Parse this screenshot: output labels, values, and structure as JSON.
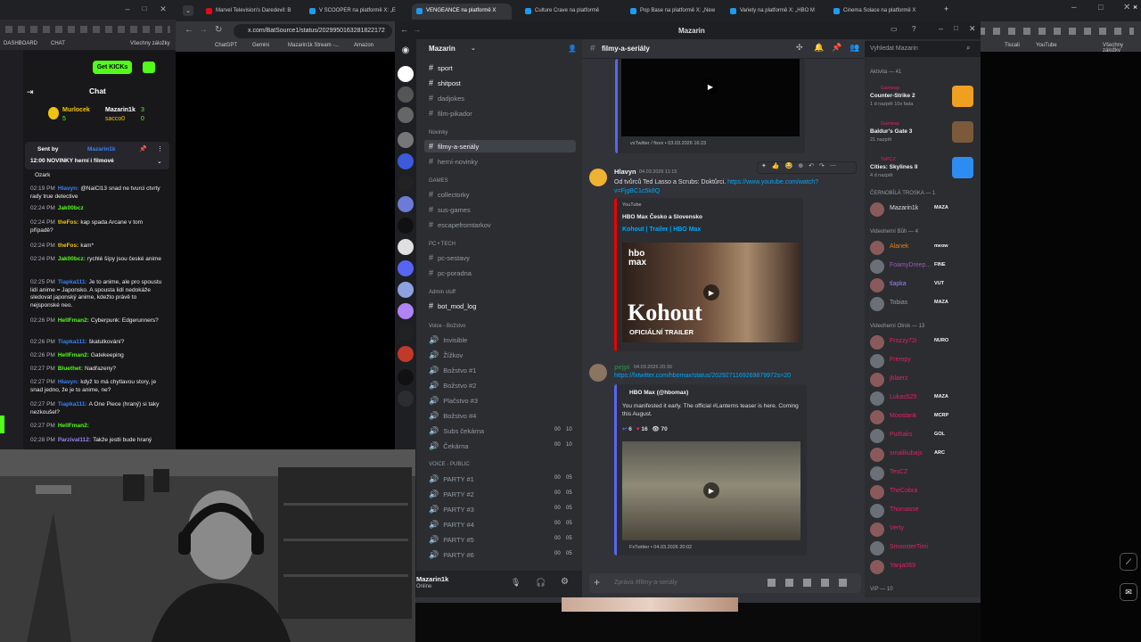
{
  "left_browser": {
    "bookmarks": [
      "DASHBOARD",
      "CHAT",
      "Všechny záložky"
    ],
    "get_kicks": "Get KICKs",
    "chat_title": "Chat",
    "top_users": {
      "first": "Murlocek",
      "first_count": "5",
      "second": "Mazarin1k",
      "second_count": "3",
      "third": "sacco0",
      "third_count": "0"
    },
    "pinned": {
      "sent_by": "Sent by",
      "sender": "Mazarin1k",
      "text": "12:00 NOVINKY herní i filmové"
    },
    "messages": [
      {
        "time": "",
        "user": "",
        "text": "Ozark"
      },
      {
        "time": "02:19 PM",
        "user": "Hlavyn:",
        "text": "@NaiCl13 snad ne tvurci ctvrty rady true detective"
      },
      {
        "time": "02:24 PM",
        "user": "Jak00bcz",
        "text": ""
      },
      {
        "time": "02:24 PM",
        "user": "theFos:",
        "text": "kap spada Arcane v tom případě?"
      },
      {
        "time": "02:24 PM",
        "user": "theFos:",
        "text": "kam*"
      },
      {
        "time": "02:24 PM",
        "user": "Jak00bcz:",
        "text": "rychlé šípy jsou české anime"
      },
      {
        "time": "02:25 PM",
        "user": "Tiapka111:",
        "text": "Je to anime, ale pro spoustu lidí anime = Japonsko. A spousta lidí nedokáže sledovat japonský anime, kdežto právě to nejsponské neo."
      },
      {
        "time": "02:26 PM",
        "user": "HellFman2:",
        "text": "Cyberpunk: Edgerunners?"
      },
      {
        "time": "02:26 PM",
        "user": "Tiapka111:",
        "text": "škatulkování?"
      },
      {
        "time": "02:26 PM",
        "user": "HellFman2:",
        "text": "Gatekeeping"
      },
      {
        "time": "02:27 PM",
        "user": "Bluethet:",
        "text": "Nadřazeny?"
      },
      {
        "time": "02:27 PM",
        "user": "Hlavyn:",
        "text": "když to má chytlavou story, je snad jedno, že je to anime, ne?"
      },
      {
        "time": "02:27 PM",
        "user": "Tiapka111:",
        "text": "A One Piece (hraný) si taky nezkoušel?"
      },
      {
        "time": "02:27 PM",
        "user": "HellFman2:",
        "text": ""
      },
      {
        "time": "02:28 PM",
        "user": "Parzival112:",
        "text": "Takže jestli bude hraný"
      }
    ]
  },
  "main_browser": {
    "tabs": [
      "Marvel Television's Daredevil: B",
      "V SCOOPER na platformě X: „E",
      "VENGEANCE na platformě X",
      "Culture Crave na platformě",
      "Pop Base na platformě X: „New",
      "Variety na platformě X: „HBO M",
      "Cinema Solace na platformě X"
    ],
    "url": "x.com/BatSource1/status/2029950163281822172",
    "bookmarks": [
      "ChatGPT",
      "Gemini",
      "Mazarin1k Stream -...",
      "Amazon"
    ],
    "bookmarks_right": [
      "Tiscali",
      "YouTube",
      "Všechny záložky"
    ]
  },
  "discord": {
    "window_title": "Mazarin",
    "server_name": "Mazarin",
    "channels": [
      {
        "name": "sport",
        "active": false
      },
      {
        "name": "shitpost",
        "active": false
      },
      {
        "name": "dadjokes",
        "active": false
      },
      {
        "name": "film-pikador",
        "active": false
      }
    ],
    "cat_novinky": "Novinky",
    "channels_novinky": [
      "filmy-a-seriály",
      "herní-novinky"
    ],
    "cat_games": "GAMES",
    "channels_games": [
      "collectorky",
      "sus-games",
      "escapefromtarkov"
    ],
    "cat_pc": "PC • TECH",
    "channels_pc": [
      "pc-sestavy",
      "pc-poradna"
    ],
    "cat_admin": "Admin stuff",
    "channels_admin": [
      "bot_mod_log"
    ],
    "cat_voice": "Voice - Božstvo",
    "voice_channels": [
      {
        "name": "Invisible",
        "a": "",
        "b": ""
      },
      {
        "name": "Žížkov",
        "a": "",
        "b": ""
      },
      {
        "name": "Božstvo #1",
        "a": "",
        "b": ""
      },
      {
        "name": "Božstvo #2",
        "a": "",
        "b": ""
      },
      {
        "name": "Plačstvo #3",
        "a": "",
        "b": ""
      },
      {
        "name": "Božstvo #4",
        "a": "",
        "b": ""
      },
      {
        "name": "Subs čekárna",
        "a": "00",
        "b": "10"
      },
      {
        "name": "Čekárna",
        "a": "00",
        "b": "10"
      }
    ],
    "cat_public": "VOICE - PUBLIC",
    "public_channels": [
      {
        "name": "PARTY #1",
        "a": "00",
        "b": "05"
      },
      {
        "name": "PARTY #2",
        "a": "00",
        "b": "05"
      },
      {
        "name": "PARTY #3",
        "a": "00",
        "b": "05"
      },
      {
        "name": "PARTY #4",
        "a": "00",
        "b": "05"
      },
      {
        "name": "PARTY #5",
        "a": "00",
        "b": "05"
      },
      {
        "name": "PARTY #6",
        "a": "00",
        "b": "05"
      },
      {
        "name": "PARTY #7",
        "a": "",
        "b": ""
      }
    ],
    "user": {
      "name": "Mazarin1k",
      "status": "Online"
    },
    "chat_channel": "filmy-a-seriály",
    "messages": {
      "m0_footer": "vxTwitter / fixvx • 03.03.2026 16:23",
      "m1_author": "Hlavyn",
      "m1_time": "04.03.2026 11:15",
      "m1_text": "Od tvůrců Ted Lasso a Scrubs: Doktůrci.",
      "m1_link": "https://www.youtube.com/watch?v=FjgBC1c5k8Q",
      "m1_embed_provider": "YouTube",
      "m1_embed_author": "HBO Max Česko a Slovensko",
      "m1_embed_title": "Kohout | Trailer | HBO Max",
      "m1_thumb_brand": "hbo max",
      "m1_thumb_title": "Kohout",
      "m1_thumb_sub": "OFICIÁLNÍ TRAILER",
      "m2_author": "pejpi",
      "m2_time": "04.03.2026 20:30",
      "m2_link": "https://fxtwitter.com/hbomax/status/2029271169269879972s=20",
      "m2_embed_author": "HBO Max (@hbomax)",
      "m2_embed_text": "You manifested it early. The official #Lanterns teaser is here. Coming this August.",
      "m2_stats": {
        "replies": "6",
        "likes": "16",
        "views": "70"
      },
      "m2_footer": "FxTwitter • 04.03.2026 20:02"
    },
    "input_placeholder": "Zpráva #filmy-a-seriály",
    "search_placeholder": "Vyhledat Mazarin",
    "activity_header": "Aktivita — 41",
    "activities": [
      {
        "user": "Gamesp",
        "game": "Counter-Strike 2",
        "detail": "1 d nazpět  10x fada"
      },
      {
        "user": "Gamesp",
        "game": "Baldur's Gate 3",
        "detail": "21 nazpět"
      },
      {
        "user": "ToPCZ",
        "game": "Cities: Skylines II",
        "detail": "4 d nazpět"
      }
    ],
    "groups": [
      {
        "label": "ČERNOBÍLÁ TROSKA — 1",
        "members": [
          {
            "name": "Mazarin1k",
            "tag": "MAZA",
            "color": "#dbdee1"
          }
        ]
      },
      {
        "label": "Videoherní Bůh — 4",
        "members": [
          {
            "name": "Alanek",
            "tag": "meow",
            "color": "#e67e22"
          },
          {
            "name": "FoamyDreep...",
            "tag": "FINE",
            "color": "#9b59b6"
          },
          {
            "name": "tlapka",
            "tag": "VUT",
            "color": "#9b84ee"
          },
          {
            "name": "Tobias",
            "tag": "MAZA",
            "color": "#949ba4"
          }
        ]
      },
      {
        "label": "Videoherní Otrok — 13",
        "members": [
          {
            "name": "Frozzy72i",
            "tag": "NURO",
            "color": "#e91e63"
          },
          {
            "name": "Frempy",
            "tag": "",
            "color": "#e91e63"
          },
          {
            "name": "jblaerz",
            "tag": "",
            "color": "#e91e63"
          },
          {
            "name": "Lukas525",
            "tag": "MAZA",
            "color": "#e91e63"
          },
          {
            "name": "Moostank",
            "tag": "MCRP",
            "color": "#e91e63"
          },
          {
            "name": "Puthaks",
            "tag": "GOL",
            "color": "#e91e63"
          },
          {
            "name": "smalikubajs",
            "tag": "ARC",
            "color": "#e91e63"
          },
          {
            "name": "TesCZ",
            "tag": "",
            "color": "#e91e63"
          },
          {
            "name": "TheCobra",
            "tag": "",
            "color": "#e91e63"
          },
          {
            "name": "Thomasse",
            "tag": "",
            "color": "#e91e63"
          },
          {
            "name": "Verty",
            "tag": "",
            "color": "#e91e63"
          },
          {
            "name": "SmoosterTimi",
            "tag": "",
            "color": "#e91e63"
          },
          {
            "name": "Yanja069",
            "tag": "",
            "color": "#e91e63"
          }
        ]
      },
      {
        "label": "VIP — 10",
        "members": []
      }
    ]
  }
}
